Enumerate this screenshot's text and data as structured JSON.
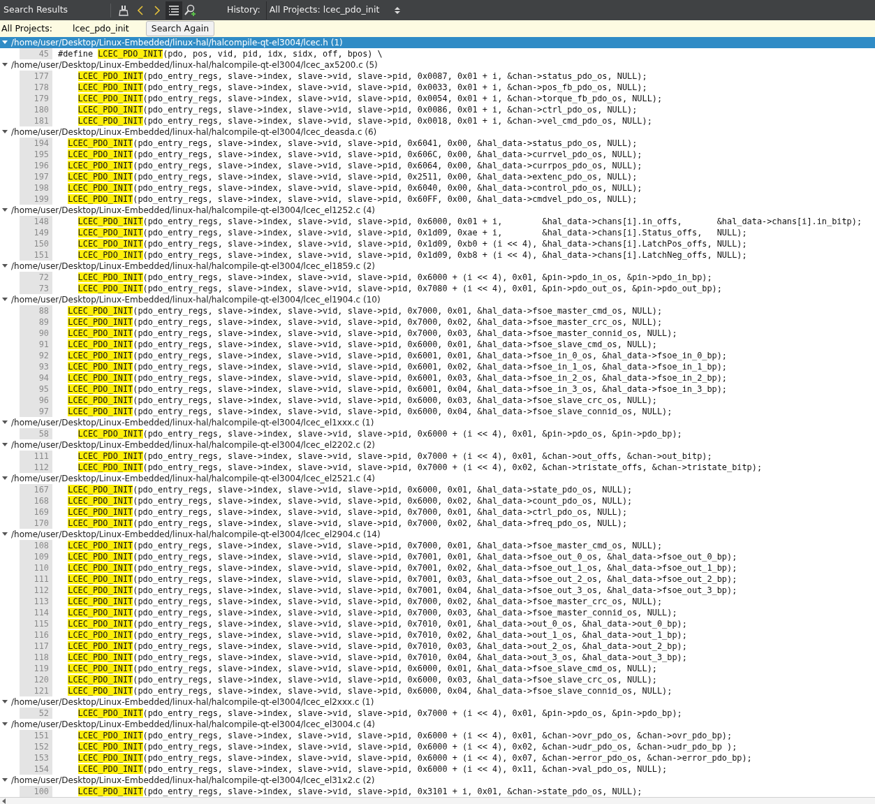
{
  "toolbar": {
    "title": "Search Results",
    "history_label": "History:",
    "history_value": "All Projects: lcec_pdo_init",
    "list_view_on": true
  },
  "info_bar": {
    "scope": "All Projects:",
    "term": "lcec_pdo_init",
    "button": "Search Again"
  },
  "files": [
    {
      "label": "/home/user/Desktop/Linux-Embedded/linux-hal/halcompile-qt-el3004/lcec.h (1)",
      "selected": true,
      "expanded": true,
      "lines": [
        {
          "num": "45",
          "kind": "flush",
          "before": "#define ",
          "match": "LCEC_PDO_INIT",
          "after": "(pdo, pos, vid, pid, idx, sidx, off, bpos) \\"
        }
      ]
    },
    {
      "label": "/home/user/Desktop/Linux-Embedded/linux-hal/halcompile-qt-el3004/lcec_ax5200.c (5)",
      "selected": false,
      "expanded": true,
      "lines": [
        {
          "num": "177",
          "kind": "deep",
          "match": "LCEC_PDO_INIT",
          "after": "(pdo_entry_regs, slave->index, slave->vid, slave->pid, 0x0087, 0x01 + i, &chan->status_pdo_os, NULL);"
        },
        {
          "num": "178",
          "kind": "deep",
          "match": "LCEC_PDO_INIT",
          "after": "(pdo_entry_regs, slave->index, slave->vid, slave->pid, 0x0033, 0x01 + i, &chan->pos_fb_pdo_os, NULL);"
        },
        {
          "num": "179",
          "kind": "deep",
          "match": "LCEC_PDO_INIT",
          "after": "(pdo_entry_regs, slave->index, slave->vid, slave->pid, 0x0054, 0x01 + i, &chan->torque_fb_pdo_os, NULL);"
        },
        {
          "num": "180",
          "kind": "deep",
          "match": "LCEC_PDO_INIT",
          "after": "(pdo_entry_regs, slave->index, slave->vid, slave->pid, 0x0086, 0x01 + i, &chan->ctrl_pdo_os, NULL);"
        },
        {
          "num": "181",
          "kind": "deep",
          "match": "LCEC_PDO_INIT",
          "after": "(pdo_entry_regs, slave->index, slave->vid, slave->pid, 0x0018, 0x01 + i, &chan->vel_cmd_pdo_os, NULL);"
        }
      ]
    },
    {
      "label": "/home/user/Desktop/Linux-Embedded/linux-hal/halcompile-qt-el3004/lcec_deasda.c (6)",
      "selected": false,
      "expanded": true,
      "lines": [
        {
          "num": "194",
          "kind": "shallow",
          "match": "LCEC_PDO_INIT",
          "after": "(pdo_entry_regs, slave->index, slave->vid, slave->pid, 0x6041, 0x00, &hal_data->status_pdo_os, NULL);"
        },
        {
          "num": "195",
          "kind": "shallow",
          "match": "LCEC_PDO_INIT",
          "after": "(pdo_entry_regs, slave->index, slave->vid, slave->pid, 0x606C, 0x00, &hal_data->currvel_pdo_os, NULL);"
        },
        {
          "num": "196",
          "kind": "shallow",
          "match": "LCEC_PDO_INIT",
          "after": "(pdo_entry_regs, slave->index, slave->vid, slave->pid, 0x6064, 0x00, &hal_data->currpos_pdo_os, NULL);"
        },
        {
          "num": "197",
          "kind": "shallow",
          "match": "LCEC_PDO_INIT",
          "after": "(pdo_entry_regs, slave->index, slave->vid, slave->pid, 0x2511, 0x00, &hal_data->extenc_pdo_os, NULL);"
        },
        {
          "num": "198",
          "kind": "shallow",
          "match": "LCEC_PDO_INIT",
          "after": "(pdo_entry_regs, slave->index, slave->vid, slave->pid, 0x6040, 0x00, &hal_data->control_pdo_os, NULL);"
        },
        {
          "num": "199",
          "kind": "shallow",
          "match": "LCEC_PDO_INIT",
          "after": "(pdo_entry_regs, slave->index, slave->vid, slave->pid, 0x60FF, 0x00, &hal_data->cmdvel_pdo_os, NULL);"
        }
      ]
    },
    {
      "label": "/home/user/Desktop/Linux-Embedded/linux-hal/halcompile-qt-el3004/lcec_el1252.c (4)",
      "selected": false,
      "expanded": true,
      "lines": [
        {
          "num": "148",
          "kind": "deep",
          "match": "LCEC_PDO_INIT",
          "after": "(pdo_entry_regs, slave->index, slave->vid, slave->pid, 0x6000, 0x01 + i,        &hal_data->chans[i].in_offs,       &hal_data->chans[i].in_bitp);"
        },
        {
          "num": "149",
          "kind": "deep",
          "match": "LCEC_PDO_INIT",
          "after": "(pdo_entry_regs, slave->index, slave->vid, slave->pid, 0x1d09, 0xae + i,        &hal_data->chans[i].Status_offs,   NULL);"
        },
        {
          "num": "150",
          "kind": "deep",
          "match": "LCEC_PDO_INIT",
          "after": "(pdo_entry_regs, slave->index, slave->vid, slave->pid, 0x1d09, 0xb0 + (i << 4), &hal_data->chans[i].LatchPos_offs, NULL);"
        },
        {
          "num": "151",
          "kind": "deep",
          "match": "LCEC_PDO_INIT",
          "after": "(pdo_entry_regs, slave->index, slave->vid, slave->pid, 0x1d09, 0xb8 + (i << 4), &hal_data->chans[i].LatchNeg_offs, NULL);"
        }
      ]
    },
    {
      "label": "/home/user/Desktop/Linux-Embedded/linux-hal/halcompile-qt-el3004/lcec_el1859.c (2)",
      "selected": false,
      "expanded": true,
      "lines": [
        {
          "num": "72",
          "kind": "deep",
          "match": "LCEC_PDO_INIT",
          "after": "(pdo_entry_regs, slave->index, slave->vid, slave->pid, 0x6000 + (i << 4), 0x01, &pin->pdo_in_os, &pin->pdo_in_bp);"
        },
        {
          "num": "73",
          "kind": "deep",
          "match": "LCEC_PDO_INIT",
          "after": "(pdo_entry_regs, slave->index, slave->vid, slave->pid, 0x7080 + (i << 4), 0x01, &pin->pdo_out_os, &pin->pdo_out_bp);"
        }
      ]
    },
    {
      "label": "/home/user/Desktop/Linux-Embedded/linux-hal/halcompile-qt-el3004/lcec_el1904.c (10)",
      "selected": false,
      "expanded": true,
      "lines": [
        {
          "num": "88",
          "kind": "shallow",
          "match": "LCEC_PDO_INIT",
          "after": "(pdo_entry_regs, slave->index, slave->vid, slave->pid, 0x7000, 0x01, &hal_data->fsoe_master_cmd_os, NULL);"
        },
        {
          "num": "89",
          "kind": "shallow",
          "match": "LCEC_PDO_INIT",
          "after": "(pdo_entry_regs, slave->index, slave->vid, slave->pid, 0x7000, 0x02, &hal_data->fsoe_master_crc_os, NULL);"
        },
        {
          "num": "90",
          "kind": "shallow",
          "match": "LCEC_PDO_INIT",
          "after": "(pdo_entry_regs, slave->index, slave->vid, slave->pid, 0x7000, 0x03, &hal_data->fsoe_master_connid_os, NULL);"
        },
        {
          "num": "91",
          "kind": "shallow",
          "match": "LCEC_PDO_INIT",
          "after": "(pdo_entry_regs, slave->index, slave->vid, slave->pid, 0x6000, 0x01, &hal_data->fsoe_slave_cmd_os, NULL);"
        },
        {
          "num": "92",
          "kind": "shallow",
          "match": "LCEC_PDO_INIT",
          "after": "(pdo_entry_regs, slave->index, slave->vid, slave->pid, 0x6001, 0x01, &hal_data->fsoe_in_0_os, &hal_data->fsoe_in_0_bp);"
        },
        {
          "num": "93",
          "kind": "shallow",
          "match": "LCEC_PDO_INIT",
          "after": "(pdo_entry_regs, slave->index, slave->vid, slave->pid, 0x6001, 0x02, &hal_data->fsoe_in_1_os, &hal_data->fsoe_in_1_bp);"
        },
        {
          "num": "94",
          "kind": "shallow",
          "match": "LCEC_PDO_INIT",
          "after": "(pdo_entry_regs, slave->index, slave->vid, slave->pid, 0x6001, 0x03, &hal_data->fsoe_in_2_os, &hal_data->fsoe_in_2_bp);"
        },
        {
          "num": "95",
          "kind": "shallow",
          "match": "LCEC_PDO_INIT",
          "after": "(pdo_entry_regs, slave->index, slave->vid, slave->pid, 0x6001, 0x04, &hal_data->fsoe_in_3_os, &hal_data->fsoe_in_3_bp);"
        },
        {
          "num": "96",
          "kind": "shallow",
          "match": "LCEC_PDO_INIT",
          "after": "(pdo_entry_regs, slave->index, slave->vid, slave->pid, 0x6000, 0x03, &hal_data->fsoe_slave_crc_os, NULL);"
        },
        {
          "num": "97",
          "kind": "shallow",
          "match": "LCEC_PDO_INIT",
          "after": "(pdo_entry_regs, slave->index, slave->vid, slave->pid, 0x6000, 0x04, &hal_data->fsoe_slave_connid_os, NULL);"
        }
      ]
    },
    {
      "label": "/home/user/Desktop/Linux-Embedded/linux-hal/halcompile-qt-el3004/lcec_el1xxx.c (1)",
      "selected": false,
      "expanded": true,
      "lines": [
        {
          "num": "58",
          "kind": "deep",
          "match": "LCEC_PDO_INIT",
          "after": "(pdo_entry_regs, slave->index, slave->vid, slave->pid, 0x6000 + (i << 4), 0x01, &pin->pdo_os, &pin->pdo_bp);"
        }
      ]
    },
    {
      "label": "/home/user/Desktop/Linux-Embedded/linux-hal/halcompile-qt-el3004/lcec_el2202.c (2)",
      "selected": false,
      "expanded": true,
      "lines": [
        {
          "num": "111",
          "kind": "deep",
          "match": "LCEC_PDO_INIT",
          "after": "(pdo_entry_regs, slave->index, slave->vid, slave->pid, 0x7000 + (i << 4), 0x01, &chan->out_offs, &chan->out_bitp);"
        },
        {
          "num": "112",
          "kind": "deep",
          "match": "LCEC_PDO_INIT",
          "after": "(pdo_entry_regs, slave->index, slave->vid, slave->pid, 0x7000 + (i << 4), 0x02, &chan->tristate_offs, &chan->tristate_bitp);"
        }
      ]
    },
    {
      "label": "/home/user/Desktop/Linux-Embedded/linux-hal/halcompile-qt-el3004/lcec_el2521.c (4)",
      "selected": false,
      "expanded": true,
      "lines": [
        {
          "num": "167",
          "kind": "shallow",
          "match": "LCEC_PDO_INIT",
          "after": "(pdo_entry_regs, slave->index, slave->vid, slave->pid, 0x6000, 0x01, &hal_data->state_pdo_os, NULL);"
        },
        {
          "num": "168",
          "kind": "shallow",
          "match": "LCEC_PDO_INIT",
          "after": "(pdo_entry_regs, slave->index, slave->vid, slave->pid, 0x6000, 0x02, &hal_data->count_pdo_os, NULL);"
        },
        {
          "num": "169",
          "kind": "shallow",
          "match": "LCEC_PDO_INIT",
          "after": "(pdo_entry_regs, slave->index, slave->vid, slave->pid, 0x7000, 0x01, &hal_data->ctrl_pdo_os, NULL);"
        },
        {
          "num": "170",
          "kind": "shallow",
          "match": "LCEC_PDO_INIT",
          "after": "(pdo_entry_regs, slave->index, slave->vid, slave->pid, 0x7000, 0x02, &hal_data->freq_pdo_os, NULL);"
        }
      ]
    },
    {
      "label": "/home/user/Desktop/Linux-Embedded/linux-hal/halcompile-qt-el3004/lcec_el2904.c (14)",
      "selected": false,
      "expanded": true,
      "lines": [
        {
          "num": "108",
          "kind": "shallow",
          "match": "LCEC_PDO_INIT",
          "after": "(pdo_entry_regs, slave->index, slave->vid, slave->pid, 0x7000, 0x01, &hal_data->fsoe_master_cmd_os, NULL);"
        },
        {
          "num": "109",
          "kind": "shallow",
          "match": "LCEC_PDO_INIT",
          "after": "(pdo_entry_regs, slave->index, slave->vid, slave->pid, 0x7001, 0x01, &hal_data->fsoe_out_0_os, &hal_data->fsoe_out_0_bp);"
        },
        {
          "num": "110",
          "kind": "shallow",
          "match": "LCEC_PDO_INIT",
          "after": "(pdo_entry_regs, slave->index, slave->vid, slave->pid, 0x7001, 0x02, &hal_data->fsoe_out_1_os, &hal_data->fsoe_out_1_bp);"
        },
        {
          "num": "111",
          "kind": "shallow",
          "match": "LCEC_PDO_INIT",
          "after": "(pdo_entry_regs, slave->index, slave->vid, slave->pid, 0x7001, 0x03, &hal_data->fsoe_out_2_os, &hal_data->fsoe_out_2_bp);"
        },
        {
          "num": "112",
          "kind": "shallow",
          "match": "LCEC_PDO_INIT",
          "after": "(pdo_entry_regs, slave->index, slave->vid, slave->pid, 0x7001, 0x04, &hal_data->fsoe_out_3_os, &hal_data->fsoe_out_3_bp);"
        },
        {
          "num": "113",
          "kind": "shallow",
          "match": "LCEC_PDO_INIT",
          "after": "(pdo_entry_regs, slave->index, slave->vid, slave->pid, 0x7000, 0x02, &hal_data->fsoe_master_crc_os, NULL);"
        },
        {
          "num": "114",
          "kind": "shallow",
          "match": "LCEC_PDO_INIT",
          "after": "(pdo_entry_regs, slave->index, slave->vid, slave->pid, 0x7000, 0x03, &hal_data->fsoe_master_connid_os, NULL);"
        },
        {
          "num": "115",
          "kind": "shallow",
          "match": "LCEC_PDO_INIT",
          "after": "(pdo_entry_regs, slave->index, slave->vid, slave->pid, 0x7010, 0x01, &hal_data->out_0_os, &hal_data->out_0_bp);"
        },
        {
          "num": "116",
          "kind": "shallow",
          "match": "LCEC_PDO_INIT",
          "after": "(pdo_entry_regs, slave->index, slave->vid, slave->pid, 0x7010, 0x02, &hal_data->out_1_os, &hal_data->out_1_bp);"
        },
        {
          "num": "117",
          "kind": "shallow",
          "match": "LCEC_PDO_INIT",
          "after": "(pdo_entry_regs, slave->index, slave->vid, slave->pid, 0x7010, 0x03, &hal_data->out_2_os, &hal_data->out_2_bp);"
        },
        {
          "num": "118",
          "kind": "shallow",
          "match": "LCEC_PDO_INIT",
          "after": "(pdo_entry_regs, slave->index, slave->vid, slave->pid, 0x7010, 0x04, &hal_data->out_3_os, &hal_data->out_3_bp);"
        },
        {
          "num": "119",
          "kind": "shallow",
          "match": "LCEC_PDO_INIT",
          "after": "(pdo_entry_regs, slave->index, slave->vid, slave->pid, 0x6000, 0x01, &hal_data->fsoe_slave_cmd_os, NULL);"
        },
        {
          "num": "120",
          "kind": "shallow",
          "match": "LCEC_PDO_INIT",
          "after": "(pdo_entry_regs, slave->index, slave->vid, slave->pid, 0x6000, 0x03, &hal_data->fsoe_slave_crc_os, NULL);"
        },
        {
          "num": "121",
          "kind": "shallow",
          "match": "LCEC_PDO_INIT",
          "after": "(pdo_entry_regs, slave->index, slave->vid, slave->pid, 0x6000, 0x04, &hal_data->fsoe_slave_connid_os, NULL);"
        }
      ]
    },
    {
      "label": "/home/user/Desktop/Linux-Embedded/linux-hal/halcompile-qt-el3004/lcec_el2xxx.c (1)",
      "selected": false,
      "expanded": true,
      "lines": [
        {
          "num": "52",
          "kind": "deep",
          "match": "LCEC_PDO_INIT",
          "after": "(pdo_entry_regs, slave->index, slave->vid, slave->pid, 0x7000 + (i << 4), 0x01, &pin->pdo_os, &pin->pdo_bp);"
        }
      ]
    },
    {
      "label": "/home/user/Desktop/Linux-Embedded/linux-hal/halcompile-qt-el3004/lcec_el3004.c (4)",
      "selected": false,
      "expanded": true,
      "lines": [
        {
          "num": "151",
          "kind": "deep",
          "match": "LCEC_PDO_INIT",
          "after": "(pdo_entry_regs, slave->index, slave->vid, slave->pid, 0x6000 + (i << 4), 0x01, &chan->ovr_pdo_os, &chan->ovr_pdo_bp);"
        },
        {
          "num": "152",
          "kind": "deep",
          "match": "LCEC_PDO_INIT",
          "after": "(pdo_entry_regs, slave->index, slave->vid, slave->pid, 0x6000 + (i << 4), 0x02, &chan->udr_pdo_os, &chan->udr_pdo_bp );"
        },
        {
          "num": "153",
          "kind": "deep",
          "match": "LCEC_PDO_INIT",
          "after": "(pdo_entry_regs, slave->index, slave->vid, slave->pid, 0x6000 + (i << 4), 0x07, &chan->error_pdo_os, &chan->error_pdo_bp);"
        },
        {
          "num": "154",
          "kind": "deep",
          "match": "LCEC_PDO_INIT",
          "after": "(pdo_entry_regs, slave->index, slave->vid, slave->pid, 0x6000 + (i << 4), 0x11, &chan->val_pdo_os, NULL);"
        }
      ]
    },
    {
      "label": "/home/user/Desktop/Linux-Embedded/linux-hal/halcompile-qt-el3004/lcec_el31x2.c (2)",
      "selected": false,
      "expanded": true,
      "lines": [
        {
          "num": "100",
          "kind": "deep",
          "match": "LCEC_PDO_INIT",
          "after": "(pdo_entry_regs, slave->index, slave->vid, slave->pid, 0x3101 + i, 0x01, &chan->state_pdo_os, NULL);"
        }
      ]
    }
  ]
}
